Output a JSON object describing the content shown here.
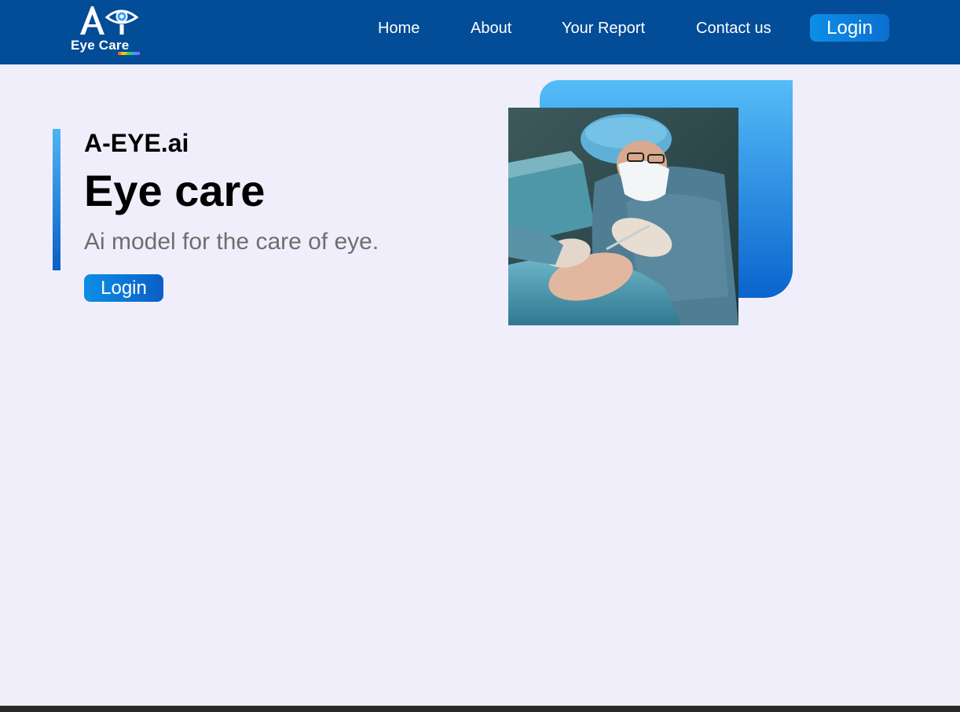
{
  "header": {
    "logo_text": "Eye Care",
    "logo_mark_text": "AI",
    "nav": [
      {
        "label": "Home"
      },
      {
        "label": "About"
      },
      {
        "label": "Your Report"
      },
      {
        "label": "Contact us"
      }
    ],
    "login_label": "Login"
  },
  "hero": {
    "brand": "A-EYE.ai",
    "title": "Eye care",
    "subtitle": "Ai model for the care of eye.",
    "login_label": "Login",
    "image_icon": "surgeon-photo"
  },
  "colors": {
    "nav_bg": "#034c97",
    "page_bg": "#f0eefb",
    "accent": "#0a6fd0",
    "accent_light": "#55bcf8"
  }
}
